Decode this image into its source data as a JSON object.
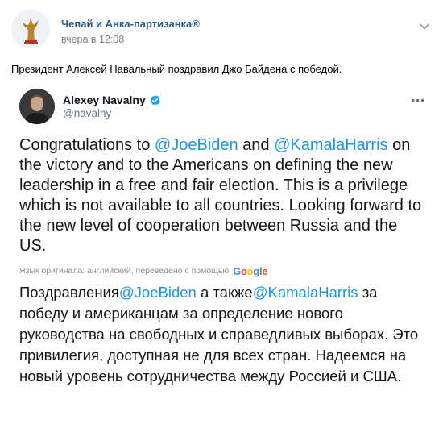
{
  "post": {
    "author": "Чепай и Анка-партизанка®",
    "time": "вчера в 12:08",
    "text": "Президент Алексей Навальный поздравил Джо Байдена с победой.",
    "menu_icon": "chevron-down-icon"
  },
  "tweet": {
    "name": "Alexey Navalny",
    "handle": "@navalny",
    "more_icon": "more-dots-icon",
    "body": {
      "p1": "Congratulations to ",
      "mention1": "@JoeBiden",
      "p2": " and ",
      "mention2": "@KamalaHarris",
      "p3": " on the victory and to the Americans on defining the new leadership in a free and fair election. This is a privilege which is not available to all countries. Looking forward to the new level of cooperation between Russia and the US."
    },
    "translate_note": "Язык оригинала: английский, переведено с помощью",
    "google": [
      "G",
      "o",
      "o",
      "g",
      "l",
      "e"
    ],
    "translated": {
      "p1": "Поздравления",
      "mention1": "@JoeBiden",
      "p2": " а также",
      "mention2": "@KamalaHarris",
      "p3": " за победу и американцам за определение нового руководства на свободных и справедливых выборах. Это привилегия, доступная не для всех стран. Надеемся на новый уровень сотрудничества между Россией и США."
    }
  },
  "colors": {
    "author_link": "#2a5885",
    "mention": "#1b95e0",
    "muted": "#828282",
    "verified": "#1da1f2"
  }
}
